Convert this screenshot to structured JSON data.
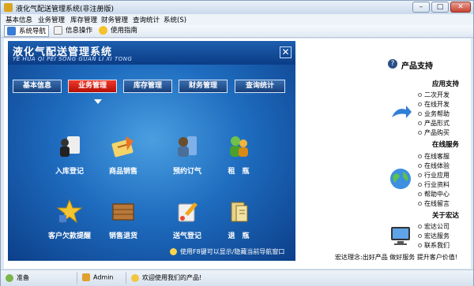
{
  "window": {
    "title": "液化气配送管理系统(非注册版)",
    "controls": [
      "minimize-icon",
      "maximize-icon",
      "close-icon"
    ]
  },
  "menu": [
    "基本信息",
    "业务管理",
    "库存管理",
    "财务管理",
    "查询统计",
    "系统(S)"
  ],
  "toolbar": [
    {
      "label": "系统导航",
      "icon": "navigation-icon",
      "active": true
    },
    {
      "label": "信息操作",
      "icon": "info-icon",
      "active": false
    },
    {
      "label": "使用指南",
      "icon": "help-icon",
      "active": false
    }
  ],
  "panel": {
    "title": "液化气配送管理系统",
    "subtitle": "YE HUA QI PEI SONG GUAN LI XI TONG",
    "tabs": [
      {
        "label": "基本信息",
        "active": false
      },
      {
        "label": "业务管理",
        "active": true
      },
      {
        "label": "库存管理",
        "active": false
      },
      {
        "label": "财务管理",
        "active": false
      },
      {
        "label": "查询统计",
        "active": false
      }
    ],
    "tiles": [
      {
        "label": "入库登记",
        "icon": "stock-in-icon"
      },
      {
        "label": "商品销售",
        "icon": "sales-icon"
      },
      {
        "label": "预约订气",
        "icon": "booking-icon"
      },
      {
        "label": "租　瓶",
        "icon": "rent-bottle-icon"
      },
      {
        "label": "客户欠款提醒",
        "icon": "debt-reminder-icon"
      },
      {
        "label": "销售退货",
        "icon": "sales-return-icon"
      },
      {
        "label": "送气登记",
        "icon": "delivery-icon"
      },
      {
        "label": "退　瓶",
        "icon": "return-bottle-icon"
      }
    ],
    "hint": "使用F8键可以显示/隐藏当前导航窗口"
  },
  "side": {
    "title": "产品支持",
    "sections": [
      {
        "title": "应用支持",
        "icon": "arrow-icon",
        "links": [
          "二次开发",
          "在线开发",
          "业务帮助",
          "产品形式",
          "产品购买"
        ]
      },
      {
        "title": "在线服务",
        "icon": "globe-icon",
        "links": [
          "在线客服",
          "在线体验",
          "行业应用",
          "行业资料",
          "帮助中心",
          "在线留言"
        ]
      },
      {
        "title": "关于宏达",
        "icon": "monitor-icon",
        "links": [
          "宏达公司",
          "宏达服务",
          "联系我们"
        ]
      }
    ],
    "slogan": "宏达理念:出好产品 做好服务 提升客户价值!"
  },
  "status": {
    "state": "准备",
    "user": "Admin",
    "welcome": "欢迎使用我们的产品!"
  },
  "colors": {
    "accent_red": "#d81a0f",
    "panel_blue": "#1f6dc0"
  }
}
